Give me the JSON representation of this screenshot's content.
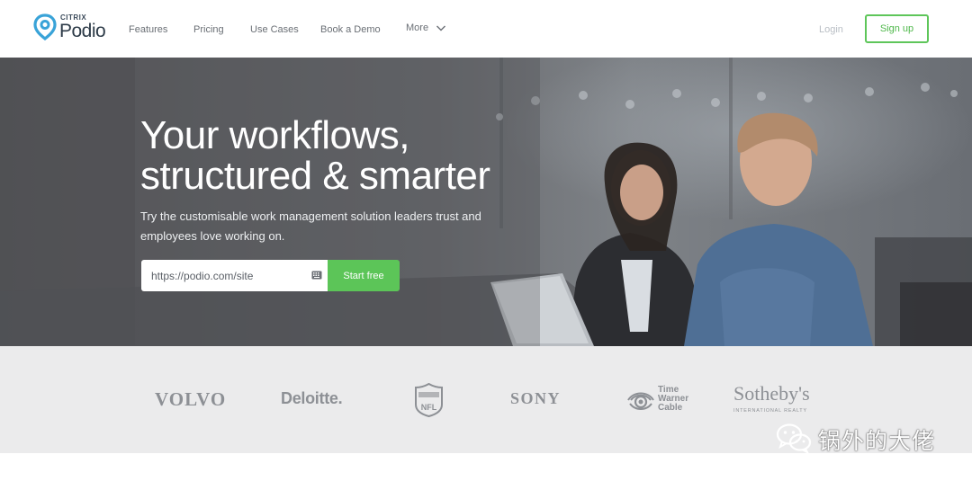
{
  "brand": {
    "small": "CITRIX",
    "name": "Podio"
  },
  "nav": {
    "links": [
      "Features",
      "Pricing",
      "Use Cases",
      "Book a Demo"
    ],
    "more_label": "More",
    "login_label": "Login",
    "signup_label": "Sign up"
  },
  "hero": {
    "title": "Your workflows,\nstructured & smarter",
    "subtitle": "Try the customisable work management solution leaders trust and employees love working on.",
    "url_value": "https://podio.com/site",
    "start_label": "Start free"
  },
  "clients": {
    "volvo": "VOLVO",
    "deloitte": "Deloitte.",
    "nfl": "NFL",
    "sony": "SONY",
    "twc": [
      "Time",
      "Warner",
      "Cable"
    ],
    "sothebys": "Sotheby's",
    "sothebys_sub": "INTERNATIONAL REALTY"
  },
  "watermark": {
    "text": "锅外的大佬"
  },
  "colors": {
    "accent_green": "#5cc558",
    "hero_text": "#ffffff",
    "logo_strip": "#ebebec"
  },
  "icons": [
    "podio-logo-icon",
    "chevron-down-icon",
    "keyboard-icon",
    "nfl-shield-icon",
    "twc-eye-icon",
    "wechat-icon"
  ]
}
